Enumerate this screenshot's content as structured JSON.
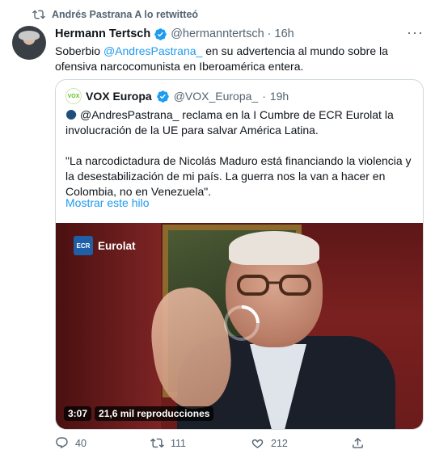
{
  "retweet": {
    "icon": "retweet-icon",
    "text": "Andrés Pastrana A lo retwitteó"
  },
  "tweet": {
    "author_name": "Hermann Tertsch",
    "author_handle": "@hermanntertsch",
    "separator": "·",
    "time": "16h",
    "more": "···",
    "text_before": "Soberbio ",
    "text_mention": "@AndresPastrana_",
    "text_after": " en su advertencia al mundo sobre la ofensiva narcocomunista en Iberoamérica entera."
  },
  "quote": {
    "avatar_text": "VOX",
    "author_name": "VOX Europa",
    "author_handle": "@VOX_Europa_",
    "separator": "·",
    "time": "19h",
    "line1": "@AndresPastrana_ reclama en la I Cumbre de ECR Eurolat la involucración de la UE para salvar América Latina.",
    "line2": "\"La narcodictadura de Nicolás Maduro está financiando la violencia y la desestabilización de mi país. La guerra nos la van a hacer en Colombia, no en Venezuela\".",
    "show_thread": "Mostrar este hilo",
    "video": {
      "overlay_logo": "ECR",
      "overlay_text": "Eurolat",
      "duration": "3:07",
      "views": "21,6 mil reproducciones"
    }
  },
  "actions": {
    "reply_count": "40",
    "retweet_count": "111",
    "like_count": "212"
  },
  "colors": {
    "accent": "#1d9bf0",
    "muted": "#536471",
    "border": "#cfd9de"
  }
}
